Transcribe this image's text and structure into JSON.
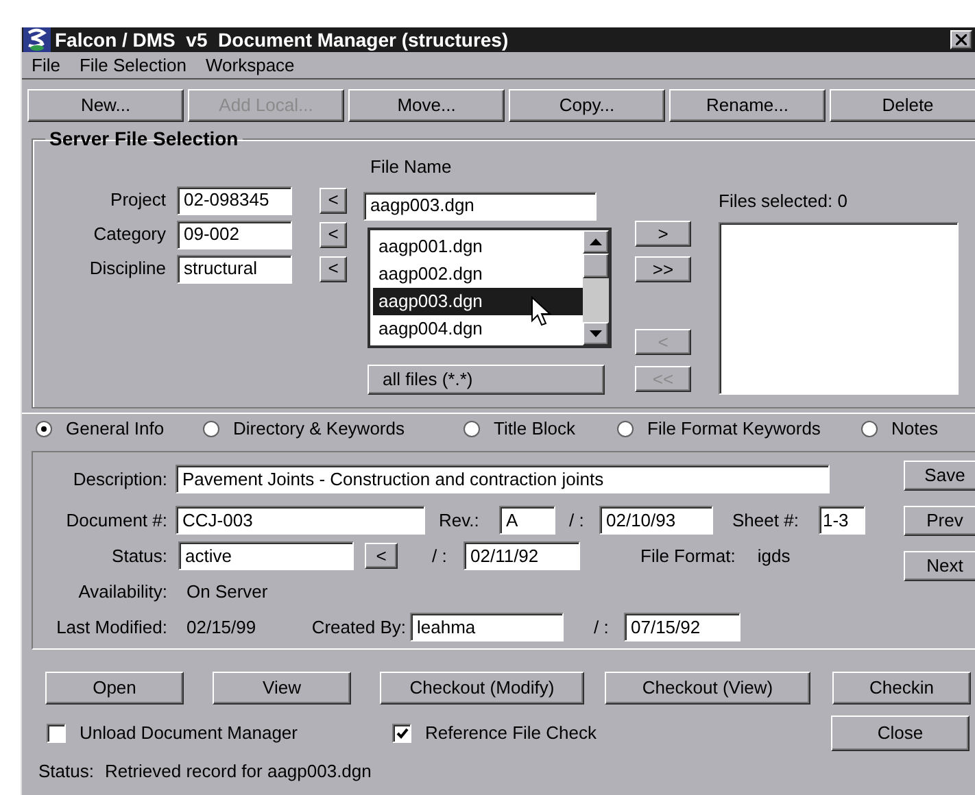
{
  "window": {
    "title": "Falcon / DMS  v5  Document Manager (structures)"
  },
  "menu": [
    "File",
    "File Selection",
    "Workspace"
  ],
  "toolbar": [
    {
      "label": "New...",
      "disabled": false
    },
    {
      "label": "Add Local...",
      "disabled": true
    },
    {
      "label": "Move...",
      "disabled": false
    },
    {
      "label": "Copy...",
      "disabled": false
    },
    {
      "label": "Rename...",
      "disabled": false
    },
    {
      "label": "Delete",
      "disabled": false
    }
  ],
  "server_file_selection": {
    "title": "Server File Selection",
    "fields": [
      {
        "label": "Project",
        "value": "02-098345",
        "button": "<"
      },
      {
        "label": "Category",
        "value": "09-002",
        "button": "<"
      },
      {
        "label": "Discipline",
        "value": "structural",
        "button": "<"
      }
    ],
    "file_name": {
      "label": "File Name",
      "value": "aagp003.dgn"
    },
    "files": [
      {
        "name": "aagp001.dgn",
        "selected": false
      },
      {
        "name": "aagp002.dgn",
        "selected": false
      },
      {
        "name": "aagp003.dgn",
        "selected": true
      },
      {
        "name": "aagp004.dgn",
        "selected": false
      }
    ],
    "all_files_button": "all files (*.*)",
    "transfer_buttons": [
      {
        "label": ">",
        "disabled": false
      },
      {
        "label": ">>",
        "disabled": false
      },
      {
        "label": "<",
        "disabled": true
      },
      {
        "label": "<<",
        "disabled": true
      }
    ],
    "selected_label": "Files selected: 0"
  },
  "tabs": [
    {
      "label": "General Info",
      "selected": true
    },
    {
      "label": "Directory & Keywords",
      "selected": false
    },
    {
      "label": "Title Block",
      "selected": false
    },
    {
      "label": "File Format Keywords",
      "selected": false
    },
    {
      "label": "Notes",
      "selected": false
    }
  ],
  "general_info": {
    "description": {
      "label": "Description:",
      "value": "Pavement Joints - Construction and contraction joints"
    },
    "document": {
      "label": "Document #:",
      "value": "CCJ-003"
    },
    "rev": {
      "label": "Rev.:",
      "value": "A"
    },
    "rev_date": {
      "label": "/ :",
      "value": "02/10/93"
    },
    "sheet": {
      "label": "Sheet #:",
      "value": "1-3"
    },
    "status": {
      "label": "Status:",
      "value": "active",
      "button": "<"
    },
    "status_date": {
      "label": "/ :",
      "value": "02/11/92"
    },
    "file_format": {
      "label": "File Format:",
      "value": "igds"
    },
    "availability": {
      "label": "Availability:",
      "value": "On Server"
    },
    "last_modified": {
      "label": "Last Modified:",
      "value": "02/15/99"
    },
    "created_by": {
      "label": "Created By:",
      "value": "leahma"
    },
    "created_date": {
      "label": "/ :",
      "value": "07/15/92"
    },
    "nav_buttons": [
      "Save",
      "Prev",
      "Next"
    ]
  },
  "actions": [
    "Open",
    "View",
    "Checkout (Modify)",
    "Checkout (View)",
    "Checkin"
  ],
  "options": [
    {
      "label": "Unload Document Manager",
      "checked": false
    },
    {
      "label": "Reference File Check",
      "checked": true
    }
  ],
  "close_button": "Close",
  "status": {
    "label": "Status:",
    "text": "Retrieved record for aagp003.dgn"
  }
}
